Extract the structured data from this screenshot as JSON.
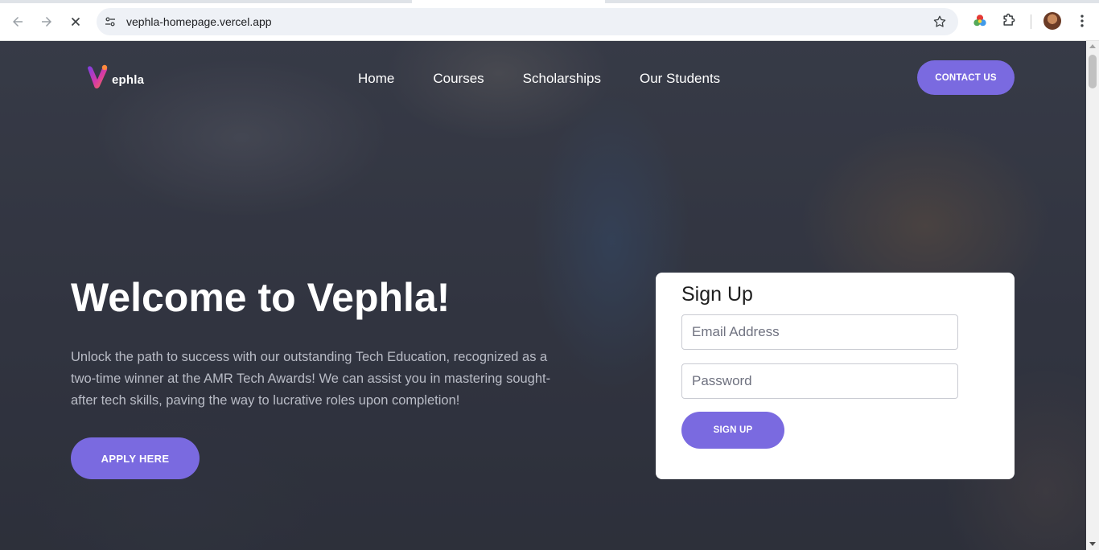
{
  "browser": {
    "url": "vephla-homepage.vercel.app",
    "icons": [
      "back-arrow-icon",
      "forward-arrow-icon",
      "stop-loading-icon",
      "site-settings-icon",
      "bookmark-star-icon",
      "color-extension-icon",
      "extensions-puzzle-icon",
      "profile-avatar-icon",
      "kebab-menu-icon"
    ]
  },
  "header": {
    "logo_text": "ephla",
    "nav": [
      "Home",
      "Courses",
      "Scholarships",
      "Our Students"
    ],
    "contact_label": "CONTACT US"
  },
  "hero": {
    "title": "Welcome to Vephla!",
    "description": "Unlock the path to success with our outstanding Tech Education, recognized as a two-time winner at the AMR Tech Awards! We can assist you in mastering sought-after tech skills, paving the way to lucrative roles upon completion!",
    "apply_label": "APPLY HERE"
  },
  "signup": {
    "title": "Sign Up",
    "email_placeholder": "Email Address",
    "password_placeholder": "Password",
    "button_label": "SIGN UP"
  },
  "colors": {
    "accent": "#7a6ae0",
    "overlay": "#3a3d4a",
    "card": "#ffffff"
  }
}
